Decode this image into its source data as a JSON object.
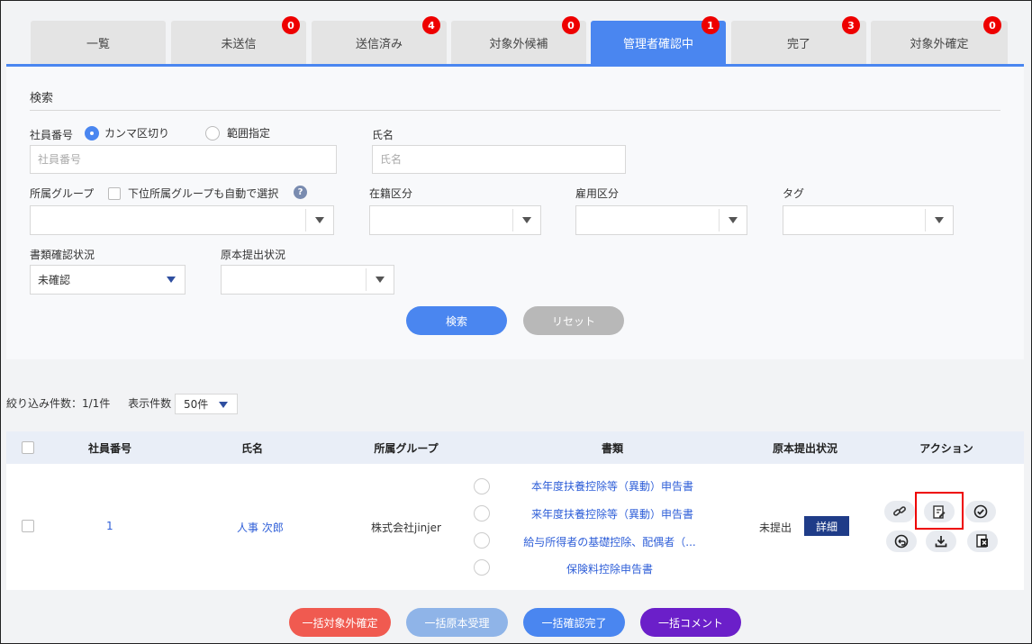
{
  "tabs": [
    {
      "label": "一覧",
      "badge": null
    },
    {
      "label": "未送信",
      "badge": "0"
    },
    {
      "label": "送信済み",
      "badge": "4"
    },
    {
      "label": "対象外候補",
      "badge": "0"
    },
    {
      "label": "管理者確認中",
      "badge": "1",
      "active": true
    },
    {
      "label": "完了",
      "badge": "3"
    },
    {
      "label": "対象外確定",
      "badge": "0"
    }
  ],
  "search": {
    "title": "検索",
    "employee_no_label": "社員番号",
    "radio_comma": "カンマ区切り",
    "radio_range": "範囲指定",
    "employee_no_placeholder": "社員番号",
    "name_label": "氏名",
    "name_placeholder": "氏名",
    "group_label": "所属グループ",
    "group_sub_checkbox": "下位所属グループも自動で選択",
    "group_help": "?",
    "enrollment_label": "在籍区分",
    "employment_label": "雇用区分",
    "tag_label": "タグ",
    "doc_status_label": "書類確認状況",
    "doc_status_value": "未確認",
    "original_status_label": "原本提出状況",
    "original_status_value": "",
    "search_button": "検索",
    "reset_button": "リセット"
  },
  "results": {
    "count_text": "絞り込み件数：1/1件",
    "per_page_label": "表示件数",
    "per_page_value": "50件"
  },
  "table": {
    "headers": {
      "employee_no": "社員番号",
      "name": "氏名",
      "group": "所属グループ",
      "documents": "書類",
      "original_status": "原本提出状況",
      "actions": "アクション"
    },
    "row": {
      "employee_no": "1",
      "name": "人事 次郎",
      "group": "株式会社jinjer",
      "documents": [
        "本年度扶養控除等（異動）申告書",
        "来年度扶養控除等（異動）申告書",
        "給与所得者の基礎控除、配偶者（...",
        "保険料控除申告書"
      ],
      "original_status": "未提出",
      "detail_button": "詳細"
    }
  },
  "bulk_actions": {
    "exclude": "一括対象外確定",
    "original_accept": "一括原本受理",
    "confirm_complete": "一括確認完了",
    "comment": "一括コメント"
  },
  "colors": {
    "primary": "#4a86f0",
    "badge": "#e00000",
    "link": "#2f5fd8",
    "navy": "#1f3c88",
    "exclude_button": "#f05a50",
    "original_button": "#8fb4e8",
    "comment_button": "#6b1fc9",
    "reset_button": "#b8b8b8"
  }
}
